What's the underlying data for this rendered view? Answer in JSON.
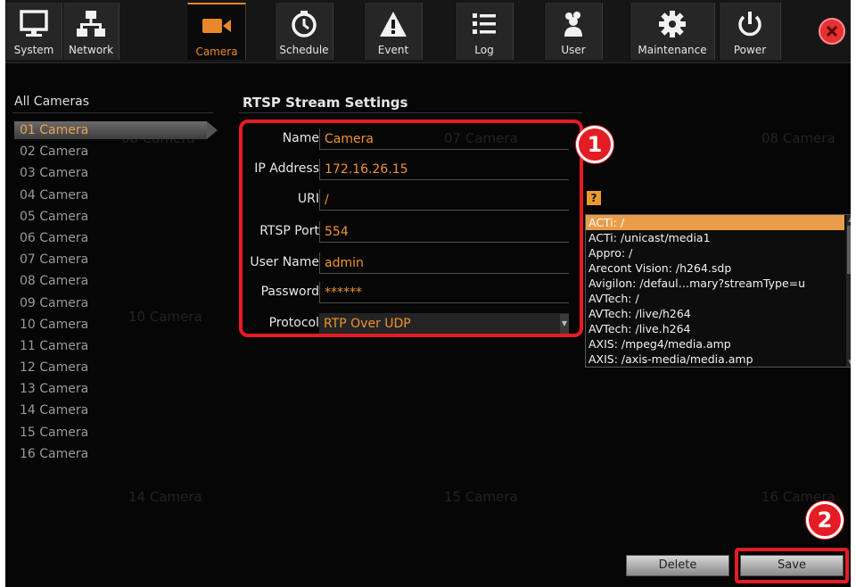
{
  "tabs": [
    {
      "label": "System",
      "icon": "monitor-icon"
    },
    {
      "label": "Network",
      "icon": "network-icon"
    },
    {
      "label": "Camera",
      "icon": "camera-icon"
    },
    {
      "label": "Schedule",
      "icon": "clock-icon"
    },
    {
      "label": "Event",
      "icon": "warning-icon"
    },
    {
      "label": "Log",
      "icon": "list-icon"
    },
    {
      "label": "User",
      "icon": "users-icon"
    },
    {
      "label": "Maintenance",
      "icon": "gear-icon"
    },
    {
      "label": "Power",
      "icon": "power-icon"
    }
  ],
  "active_tab": "Camera",
  "background_cameras": [
    "08 Camera",
    "07 Camera",
    "08 Camera",
    "10 Camera",
    "14 Camera",
    "15 Camera",
    "16 Camera"
  ],
  "sidebar": {
    "title": "All Cameras",
    "items": [
      "01 Camera",
      "02 Camera",
      "03 Camera",
      "04 Camera",
      "05 Camera",
      "06 Camera",
      "07 Camera",
      "08 Camera",
      "09 Camera",
      "10 Camera",
      "11 Camera",
      "12 Camera",
      "13 Camera",
      "14 Camera",
      "15 Camera",
      "16 Camera"
    ],
    "selected": "01 Camera"
  },
  "rtsp": {
    "title": "RTSP Stream Settings",
    "name_label": "Name",
    "name_value": "Camera",
    "ip_label": "IP Address",
    "ip_value": "172.16.26.15",
    "uri_label": "URI",
    "uri_value": "/",
    "port_label": "RTSP Port",
    "port_value": "554",
    "user_label": "User Name",
    "user_value": "admin",
    "password_label": "Password",
    "password_value": "******",
    "protocol_label": "Protocol",
    "protocol_value": "RTP Over UDP"
  },
  "help_label": "?",
  "uri_options": [
    "ACTi: /",
    "ACTi: /unicast/media1",
    "Appro: /",
    "Arecont Vision: /h264.sdp",
    "Avigilon: /defaul…mary?streamType=u",
    "AVTech: /",
    "AVTech: /live/h264",
    "AVTech: /live.h264",
    "AXIS: /mpeg4/media.amp",
    "AXIS: /axis-media/media.amp"
  ],
  "uri_selected": "ACTi: /",
  "markers": {
    "one": "1",
    "two": "2"
  },
  "buttons": {
    "delete": "Delete",
    "save": "Save"
  },
  "colors": {
    "accent": "#e9872b",
    "highlight": "#e51c24",
    "background": "#060606"
  }
}
